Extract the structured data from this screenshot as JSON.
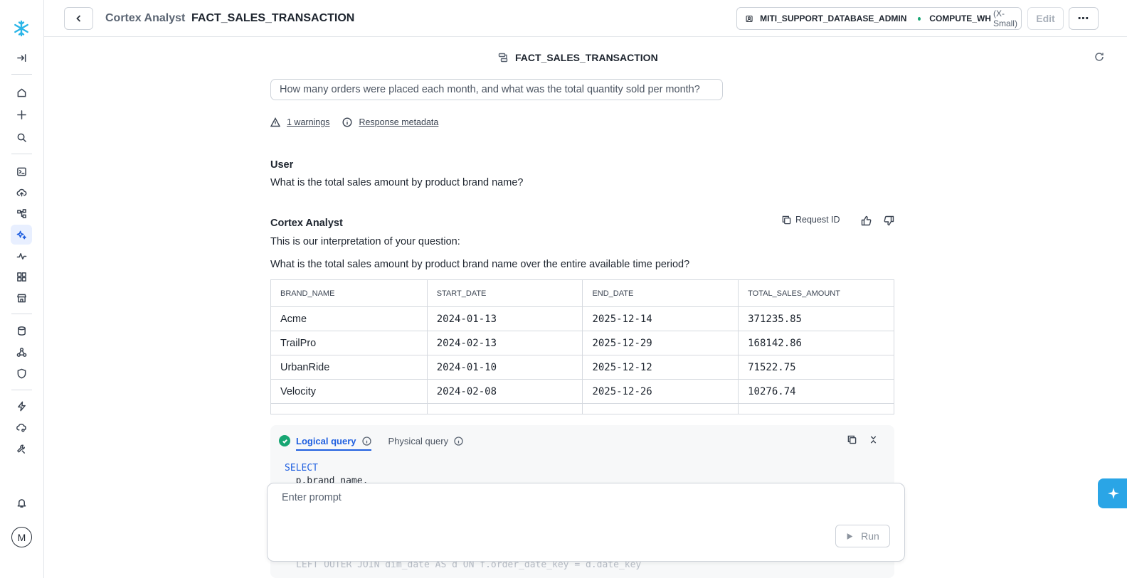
{
  "header": {
    "app": "Cortex Analyst",
    "object": "FACT_SALES_TRANSACTION",
    "role": "MITI_SUPPORT_DATABASE_ADMIN",
    "warehouse": "COMPUTE_WH",
    "warehouse_size": "(X-Small)",
    "edit": "Edit",
    "more": "⋯"
  },
  "content": {
    "title": "FACT_SALES_TRANSACTION",
    "suggested_question": "How many orders were placed each month, and what was the total quantity sold per month?",
    "warnings_link": "1 warnings",
    "metadata_link": "Response metadata"
  },
  "conversation": {
    "user_label": "User",
    "user_message": "What is the total sales amount by product brand name?",
    "assistant_label": "Cortex Analyst",
    "request_id": "Request ID",
    "interpretation_intro": "This is our interpretation of your question:",
    "interpretation": "What is the total sales amount by product brand name over the entire available time period?"
  },
  "results": {
    "columns": [
      "BRAND_NAME",
      "START_DATE",
      "END_DATE",
      "TOTAL_SALES_AMOUNT"
    ],
    "rows": [
      [
        "Acme",
        "2024-01-13",
        "2025-12-14",
        "371235.85"
      ],
      [
        "TrailPro",
        "2024-02-13",
        "2025-12-29",
        "168142.86"
      ],
      [
        "UrbanRide",
        "2024-01-10",
        "2025-12-12",
        "71522.75"
      ],
      [
        "Velocity",
        "2024-02-08",
        "2025-12-26",
        "10276.74"
      ]
    ]
  },
  "query": {
    "tab_logical": "Logical query",
    "tab_physical": "Physical query",
    "line1": "SELECT",
    "line2": "  p.brand_name,",
    "faint_line": "LEFT OUTER JOIN dim_date AS d ON f.order_date_key = d.date_key"
  },
  "prompt": {
    "placeholder": "Enter prompt",
    "run": "Run"
  },
  "sidebar": {
    "avatar": "M"
  },
  "colors": {
    "accent": "#1f5fe0",
    "success": "#17a673",
    "copilot": "#2aa5e6",
    "snowflake": "#29b5e8"
  }
}
